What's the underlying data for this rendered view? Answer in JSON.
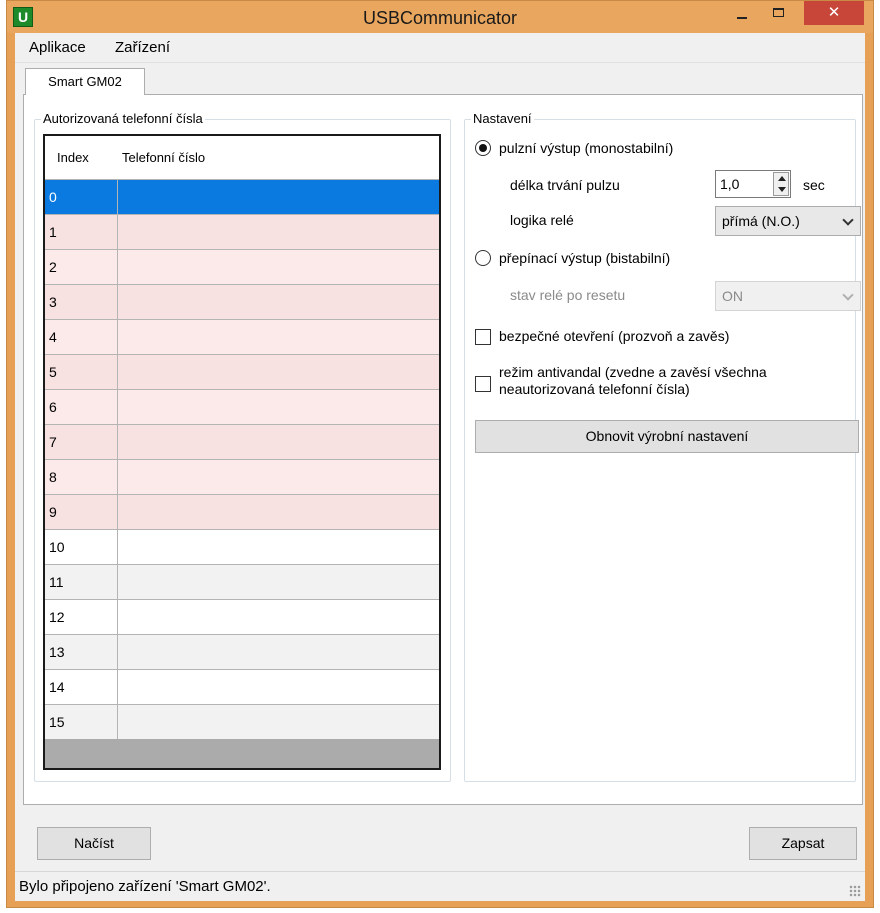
{
  "window": {
    "title": "USBCommunicator",
    "app_icon_letter": "U",
    "close_glyph": "✕"
  },
  "menu": [
    "Aplikace",
    "Zařízení"
  ],
  "tab": {
    "label": "Smart GM02"
  },
  "numbers_group": {
    "title": "Autorizovaná telefonní čísla",
    "columns": [
      "Index",
      "Telefonní číslo"
    ],
    "rows": [
      {
        "index": "0",
        "phone": ""
      },
      {
        "index": "1",
        "phone": ""
      },
      {
        "index": "2",
        "phone": ""
      },
      {
        "index": "3",
        "phone": ""
      },
      {
        "index": "4",
        "phone": ""
      },
      {
        "index": "5",
        "phone": ""
      },
      {
        "index": "6",
        "phone": ""
      },
      {
        "index": "7",
        "phone": ""
      },
      {
        "index": "8",
        "phone": ""
      },
      {
        "index": "9",
        "phone": ""
      },
      {
        "index": "10",
        "phone": ""
      },
      {
        "index": "11",
        "phone": ""
      },
      {
        "index": "12",
        "phone": ""
      },
      {
        "index": "13",
        "phone": ""
      },
      {
        "index": "14",
        "phone": ""
      },
      {
        "index": "15",
        "phone": ""
      }
    ],
    "selected_index": "0"
  },
  "settings": {
    "title": "Nastavení",
    "pulse_output": {
      "label": "pulzní výstup (monostabilní)",
      "checked": true
    },
    "pulse_length": {
      "label": "délka trvání pulzu",
      "value": "1,0",
      "unit": "sec"
    },
    "relay_logic": {
      "label": "logika relé",
      "value": "přímá (N.O.)"
    },
    "toggle_output": {
      "label": "přepínací výstup (bistabilní)",
      "checked": false
    },
    "relay_state_after_reset": {
      "label": "stav relé po resetu",
      "value": "ON",
      "disabled": true
    },
    "safe_open": {
      "label": "bezpečné otevření (prozvoň a zavěs)",
      "checked": false
    },
    "antivandal": {
      "label_line1": "režim antivandal (zvedne a zavěsí všechna",
      "label_line2": "neautorizovaná telefonní čísla)",
      "checked": false
    },
    "factory_reset_button": "Obnovit výrobní nastavení"
  },
  "buttons": {
    "load": "Načíst",
    "write": "Zapsat"
  },
  "status": {
    "text": "Bylo připojeno zařízení 'Smart GM02'."
  },
  "colors": {
    "titlebar": "#e9a65e",
    "close_button": "#c8453a",
    "selected_row": "#0a7ae0",
    "pink_row": "#f7e1e1"
  }
}
